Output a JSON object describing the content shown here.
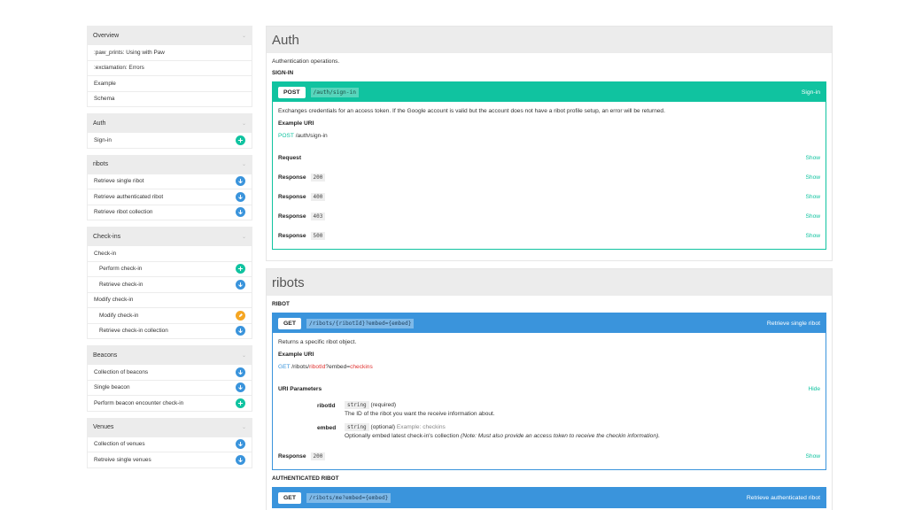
{
  "sidebar": {
    "groups": [
      {
        "title": "Overview",
        "items": [
          {
            "label": ":paw_prints: Using with Paw"
          },
          {
            "label": ":exclamation: Errors"
          },
          {
            "label": "Example"
          },
          {
            "label": "Schema"
          }
        ]
      },
      {
        "title": "Auth",
        "items": [
          {
            "label": "Sign-in",
            "icon": "plus-icon",
            "color": "#10c3a0"
          }
        ]
      },
      {
        "title": "ribots",
        "items": [
          {
            "label": "Retrieve single ribot",
            "icon": "arrow-down-icon",
            "color": "#3a94dc"
          },
          {
            "label": "Retrieve authenticated ribot",
            "icon": "arrow-down-icon",
            "color": "#3a94dc"
          },
          {
            "label": "Retrieve ribot collection",
            "icon": "arrow-down-icon",
            "color": "#3a94dc"
          }
        ]
      },
      {
        "title": "Check-ins",
        "items": [
          {
            "label": "Check-in"
          },
          {
            "label": "Perform check-in",
            "icon": "plus-icon",
            "color": "#10c3a0"
          },
          {
            "label": "Retrieve check-in",
            "icon": "arrow-down-icon",
            "color": "#3a94dc"
          },
          {
            "label": "Modify check-in"
          },
          {
            "label": "Modify check-in",
            "icon": "pencil-icon",
            "color": "#f5a623"
          },
          {
            "label": "Retrieve check-in collection",
            "icon": "arrow-down-icon",
            "color": "#3a94dc"
          }
        ]
      },
      {
        "title": "Beacons",
        "items": [
          {
            "label": "Collection of beacons",
            "icon": "arrow-down-icon",
            "color": "#3a94dc"
          },
          {
            "label": "Single beacon",
            "icon": "arrow-down-icon",
            "color": "#3a94dc"
          },
          {
            "label": "Perform beacon encounter check-in",
            "icon": "plus-icon",
            "color": "#10c3a0"
          }
        ]
      },
      {
        "title": "Venues",
        "items": [
          {
            "label": "Collection of venues",
            "icon": "arrow-down-icon",
            "color": "#3a94dc"
          },
          {
            "label": "Retreive single venues",
            "icon": "arrow-down-icon",
            "color": "#3a94dc"
          }
        ]
      }
    ]
  },
  "auth": {
    "title": "Auth",
    "description": "Authentication operations.",
    "subtitle": "SIGN-IN",
    "endpoint": {
      "method": "POST",
      "path": "/auth/sign-in",
      "name": "Sign-in",
      "description": "Exchanges credentials for an access token. If the Google account is valid but the account does not have a ribot profile setup, an error will be returned.",
      "example_label": "Example URI",
      "example_method": "POST",
      "example_path": "/auth/sign-in",
      "request_label": "Request",
      "show_label": "Show",
      "response_label": "Response",
      "responses": [
        "200",
        "400",
        "403",
        "500"
      ]
    }
  },
  "ribots": {
    "title": "ribots",
    "subtitle": "RIBOT",
    "endpoint": {
      "method": "GET",
      "path": "/ribots/{ribotId}?embed={embed}",
      "name": "Retrieve single ribot",
      "description": "Returns a specific ribot object.",
      "example_label": "Example URI",
      "example_method": "GET",
      "example_path_1": "/ribots/",
      "example_path_var": "ribotId",
      "example_path_2": "?embed=",
      "example_path_var2": "checkins",
      "uri_params_label": "URI Parameters",
      "hide_label": "Hide",
      "params": [
        {
          "name": "ribotId",
          "type": "string",
          "req": "(required)",
          "example": "",
          "desc": "The ID of the ribot you want the receive information about.",
          "note": ""
        },
        {
          "name": "embed",
          "type": "string",
          "req": "(optional)",
          "example": "Example: checkins",
          "desc": "Optionally embed latest check-in's collection",
          "note": "(Note: Must also provide an access token to receive the checkin information)."
        }
      ],
      "response_label": "Response",
      "response_code": "200",
      "show_label": "Show"
    },
    "subtitle2": "AUTHENTICATED RIBOT",
    "endpoint2": {
      "method": "GET",
      "path": "/ribots/me?embed={embed}",
      "name": "Retrieve authenticated ribot"
    }
  }
}
